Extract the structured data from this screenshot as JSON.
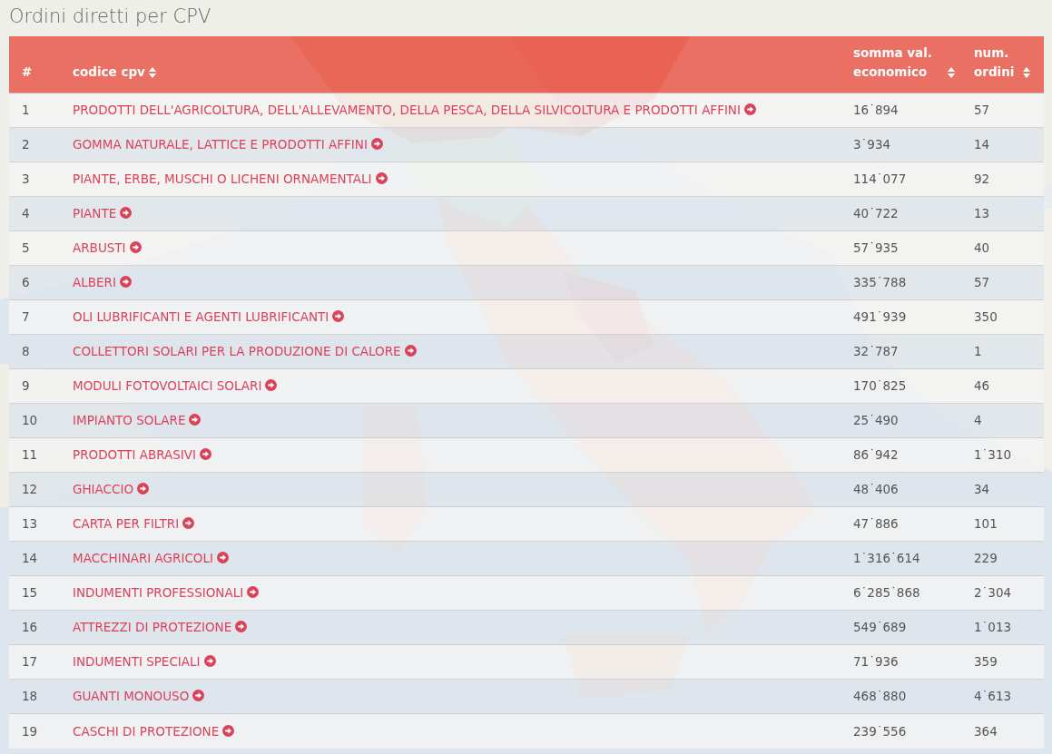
{
  "title": "Ordini diretti per CPV",
  "table": {
    "columns": [
      {
        "label": "#",
        "sortable": false
      },
      {
        "label": "codice cpv",
        "sortable": true
      },
      {
        "label": "somma val. economico",
        "sortable": true
      },
      {
        "label": "num. ordini",
        "sortable": true
      }
    ],
    "rows": [
      {
        "index": "1",
        "cpv": "PRODOTTI DELL'AGRICOLTURA, DELL'ALLEVAMENTO, DELLA PESCA, DELLA SILVICOLTURA E PRODOTTI AFFINI",
        "value": "16˙894",
        "orders": "57"
      },
      {
        "index": "2",
        "cpv": "GOMMA NATURALE, LATTICE E PRODOTTI AFFINI",
        "value": "3˙934",
        "orders": "14"
      },
      {
        "index": "3",
        "cpv": "PIANTE, ERBE, MUSCHI O LICHENI ORNAMENTALI",
        "value": "114˙077",
        "orders": "92"
      },
      {
        "index": "4",
        "cpv": "PIANTE",
        "value": "40˙722",
        "orders": "13"
      },
      {
        "index": "5",
        "cpv": "ARBUSTI",
        "value": "57˙935",
        "orders": "40"
      },
      {
        "index": "6",
        "cpv": "ALBERI",
        "value": "335˙788",
        "orders": "57"
      },
      {
        "index": "7",
        "cpv": "OLI LUBRIFICANTI E AGENTI LUBRIFICANTI",
        "value": "491˙939",
        "orders": "350"
      },
      {
        "index": "8",
        "cpv": "COLLETTORI SOLARI PER LA PRODUZIONE DI CALORE",
        "value": "32˙787",
        "orders": "1"
      },
      {
        "index": "9",
        "cpv": "MODULI FOTOVOLTAICI SOLARI",
        "value": "170˙825",
        "orders": "46"
      },
      {
        "index": "10",
        "cpv": "IMPIANTO SOLARE",
        "value": "25˙490",
        "orders": "4"
      },
      {
        "index": "11",
        "cpv": "PRODOTTI ABRASIVI",
        "value": "86˙942",
        "orders": "1˙310"
      },
      {
        "index": "12",
        "cpv": "GHIACCIO",
        "value": "48˙406",
        "orders": "34"
      },
      {
        "index": "13",
        "cpv": "CARTA PER FILTRI",
        "value": "47˙886",
        "orders": "101"
      },
      {
        "index": "14",
        "cpv": "MACCHINARI AGRICOLI",
        "value": "1˙316˙614",
        "orders": "229"
      },
      {
        "index": "15",
        "cpv": "INDUMENTI PROFESSIONALI",
        "value": "6˙285˙868",
        "orders": "2˙304"
      },
      {
        "index": "16",
        "cpv": "ATTREZZI DI PROTEZIONE",
        "value": "549˙689",
        "orders": "1˙013"
      },
      {
        "index": "17",
        "cpv": "INDUMENTI SPECIALI",
        "value": "71˙936",
        "orders": "359"
      },
      {
        "index": "18",
        "cpv": "GUANTI MONOUSO",
        "value": "468˙880",
        "orders": "4˙613"
      },
      {
        "index": "19",
        "cpv": "CASCHI DI PROTEZIONE",
        "value": "239˙556",
        "orders": "364"
      }
    ]
  }
}
